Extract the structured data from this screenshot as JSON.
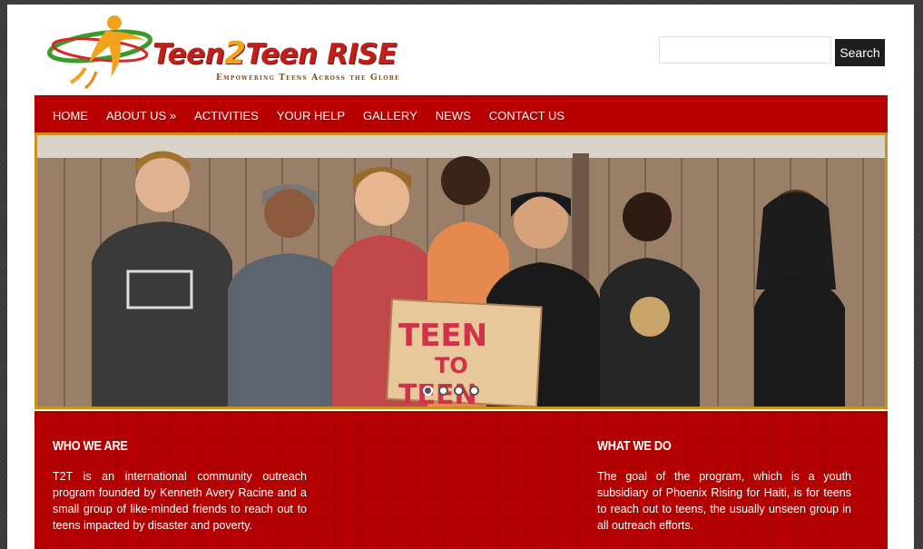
{
  "header": {
    "logo_title": "Teen2Teen RISE",
    "logo_title_part1": "Teen",
    "logo_title_part2": "2",
    "logo_title_part3": "Teen RISE",
    "tagline": "Empowering Teens Across the Globe",
    "logo_icon": "figure-swoosh-icon"
  },
  "search": {
    "placeholder": "",
    "value": "",
    "button_label": "Search"
  },
  "nav": {
    "items": [
      {
        "label": "HOME"
      },
      {
        "label": "ABOUT US »"
      },
      {
        "label": "ACTIVITIES"
      },
      {
        "label": "YOUR HELP"
      },
      {
        "label": "GALLERY"
      },
      {
        "label": "NEWS"
      },
      {
        "label": "CONTACT US"
      }
    ]
  },
  "slider": {
    "sign_text_line1": "TEEN",
    "sign_text_line2": "TO",
    "sign_text_line3": "TEEN",
    "slide_count": 4,
    "active_slide": 1
  },
  "sections": {
    "who": {
      "heading": "WHO WE ARE",
      "body": "T2T is an international community outreach program founded by Kenneth Avery Racine and a small group of like-minded friends to reach out to teens impacted by disaster and poverty."
    },
    "what": {
      "heading": "WHAT WE DO",
      "body": "The goal of the program, which is a youth subsidiary of Phoenix Rising for Haiti, is for teens to reach out to teens, the usually unseen group in all outreach efforts."
    }
  },
  "colors": {
    "brand_red": "#b80000",
    "accent_gold": "#c8921c",
    "logo_orange": "#f3a21e"
  }
}
